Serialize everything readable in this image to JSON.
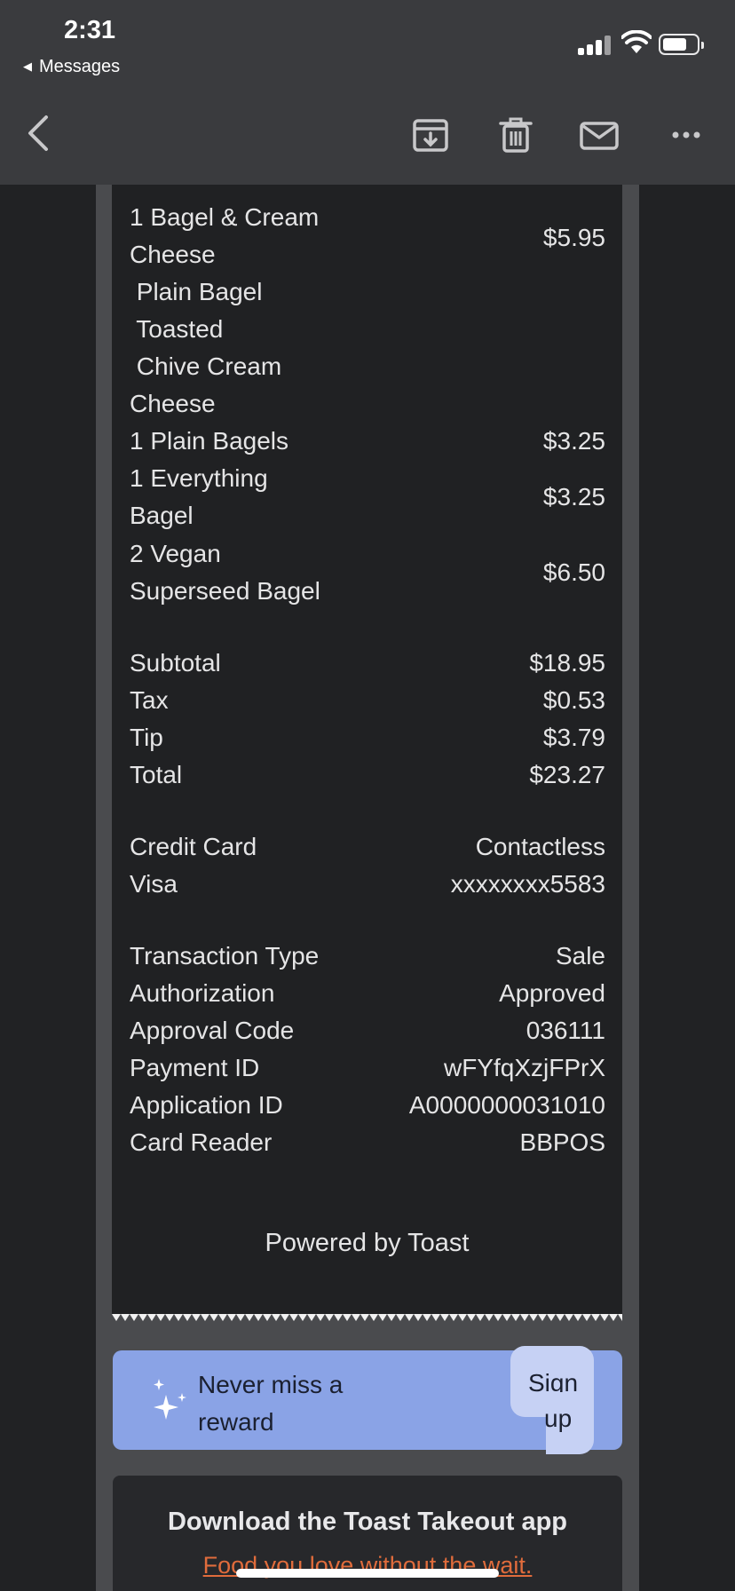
{
  "status_bar": {
    "time": "2:31",
    "back_app": "Messages"
  },
  "toolbar": {
    "icons": [
      "back-chevron-icon",
      "archive-icon",
      "trash-icon",
      "mail-icon",
      "more-icon"
    ]
  },
  "items": [
    {
      "lines": [
        "1 Bagel & Cream",
        "Cheese",
        " Plain Bagel",
        " Toasted",
        " Chive Cream",
        "Cheese"
      ],
      "price": "$5.95"
    },
    {
      "lines": [
        "1 Plain Bagels"
      ],
      "price": "$3.25"
    },
    {
      "lines": [
        "1 Everything",
        "Bagel"
      ],
      "price": "$3.25"
    },
    {
      "lines": [
        "2 Vegan",
        "Superseed Bagel"
      ],
      "price": "$6.50"
    }
  ],
  "totals": [
    {
      "label": "Subtotal",
      "value": "$18.95"
    },
    {
      "label": "Tax",
      "value": "$0.53"
    },
    {
      "label": "Tip",
      "value": "$3.79"
    },
    {
      "label": "Total",
      "value": "$23.27"
    }
  ],
  "payment": [
    {
      "label": "Credit Card",
      "value": "Contactless"
    },
    {
      "label": "Visa",
      "value": "xxxxxxxx5583"
    }
  ],
  "transaction": [
    {
      "label": "Transaction Type",
      "value": "Sale"
    },
    {
      "label": "Authorization",
      "value": "Approved"
    },
    {
      "label": "Approval Code",
      "value": "036111"
    },
    {
      "label": "Payment ID",
      "value": "wFYfqXzjFPrX"
    },
    {
      "label": "Application ID",
      "value": "A0000000031010"
    },
    {
      "label": "Card Reader",
      "value": "BBPOS"
    }
  ],
  "powered_by": "Powered by Toast",
  "reward": {
    "text": "Never miss a\nreward",
    "signup_line1": "Sign",
    "signup_line2": "up"
  },
  "download": {
    "title": "Download the Toast Takeout app",
    "subtitle": "Food you love without the wait."
  },
  "colors": {
    "accent": "#8aa3e6",
    "link": "#e06c3c",
    "background": "#212224"
  }
}
